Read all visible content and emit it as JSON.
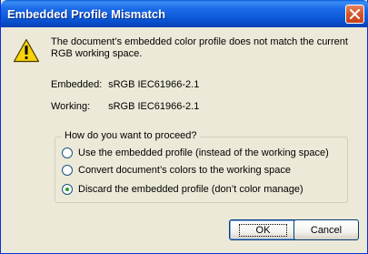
{
  "window": {
    "title": "Embedded Profile Mismatch"
  },
  "message": "The document’s embedded color profile does not match the current RGB working space.",
  "profiles": {
    "embedded_label": "Embedded:",
    "embedded_value": "sRGB IEC61966-2.1",
    "working_label": "Working:",
    "working_value": "sRGB IEC61966-2.1"
  },
  "options": {
    "legend": "How do you want to proceed?",
    "items": [
      {
        "label": "Use the embedded profile (instead of the working space)",
        "selected": false
      },
      {
        "label": "Convert document’s colors to the working space",
        "selected": false
      },
      {
        "label": "Discard the embedded profile (don’t color manage)",
        "selected": true
      }
    ]
  },
  "buttons": {
    "ok": "OK",
    "cancel": "Cancel"
  },
  "icons": {
    "warning": "warning-icon",
    "close": "close-icon"
  },
  "colors": {
    "titlebar": "#0a57d6",
    "close_button": "#d4552c",
    "dialog_bg": "#ece9d8",
    "warning_fill": "#f8d20a",
    "radio_dot": "#21a121"
  }
}
